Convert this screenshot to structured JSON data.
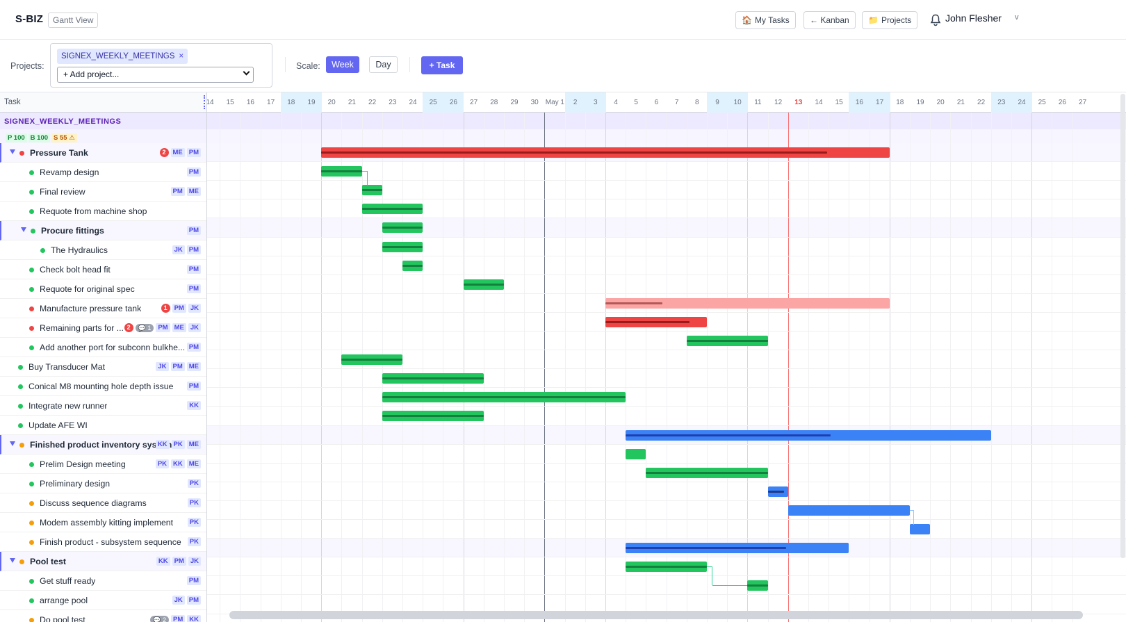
{
  "app": {
    "brand": "S-BIZ",
    "view": "Gantt View"
  },
  "nav": {
    "my_tasks": "My Tasks",
    "kanban": "← Kanban",
    "projects": "Projects",
    "user": "John Flesher",
    "user_caret": "v"
  },
  "filters": {
    "projects_label": "Projects:",
    "project_chip": "SIGNEX_WEEKLY_MEETINGS",
    "chip_remove": "×",
    "add_project": "+ Add project...",
    "scale_label": "Scale:",
    "scale_week": "Week",
    "scale_day": "Day",
    "add_task": "+ Task"
  },
  "gantt": {
    "task_col_header": "Task",
    "project_title": "SIGNEX_WEEKLY_MEETINGS",
    "stats": {
      "p": "P 100",
      "b": "B 100",
      "s": "S 55 ⚠"
    },
    "timescale": [
      "14",
      "15",
      "16",
      "17",
      "18",
      "19",
      "20",
      "21",
      "22",
      "23",
      "24",
      "25",
      "26",
      "27",
      "28",
      "29",
      "30",
      "May 1",
      "2",
      "3",
      "4",
      "5",
      "6",
      "7",
      "8",
      "9",
      "10",
      "11",
      "12",
      "13",
      "14",
      "15",
      "16",
      "17",
      "18",
      "19",
      "20",
      "21",
      "22",
      "23",
      "24",
      "25",
      "26",
      "27"
    ],
    "weekend_idx": [
      4,
      5,
      11,
      12,
      18,
      19,
      25,
      26,
      32,
      33,
      39,
      40
    ],
    "today_idx": 29,
    "first_day": 14,
    "tasks": [
      {
        "name": "Pressure Tank",
        "level": 0,
        "parent": true,
        "dot": "#ef4444",
        "badge": "2",
        "comments": "",
        "tags": [
          "ME",
          "PM"
        ],
        "bar": {
          "start": 6,
          "end": 34,
          "color": "#ef4444",
          "prog_color": "#991b1b",
          "progress": 0.89
        }
      },
      {
        "name": "Revamp design",
        "level": 1,
        "parent": false,
        "dot": "#22c55e",
        "badge": "",
        "comments": "",
        "tags": [
          "PM"
        ],
        "bar": {
          "start": 6,
          "end": 8,
          "color": "#22c55e",
          "prog_color": "#15803d",
          "progress": 1
        }
      },
      {
        "name": "Final review",
        "level": 1,
        "parent": false,
        "dot": "#22c55e",
        "badge": "",
        "comments": "",
        "tags": [
          "PM",
          "ME"
        ],
        "bar": {
          "start": 8,
          "end": 9,
          "color": "#22c55e",
          "prog_color": "#15803d",
          "progress": 1
        }
      },
      {
        "name": "Requote from machine shop",
        "level": 1,
        "parent": false,
        "dot": "#22c55e",
        "badge": "",
        "comments": "",
        "tags": [],
        "bar": {
          "start": 8,
          "end": 11,
          "color": "#22c55e",
          "prog_color": "#15803d",
          "progress": 1
        }
      },
      {
        "name": "Procure fittings",
        "level": 1,
        "parent": true,
        "dot": "#22c55e",
        "badge": "",
        "comments": "",
        "tags": [
          "PM"
        ],
        "bar": {
          "start": 9,
          "end": 11,
          "color": "#22c55e",
          "prog_color": "#15803d",
          "progress": 1
        }
      },
      {
        "name": "The Hydraulics",
        "level": 2,
        "parent": false,
        "dot": "#22c55e",
        "badge": "",
        "comments": "",
        "tags": [
          "JK",
          "PM"
        ],
        "bar": {
          "start": 9,
          "end": 11,
          "color": "#22c55e",
          "prog_color": "#15803d",
          "progress": 1
        }
      },
      {
        "name": "Check bolt head fit",
        "level": 1,
        "parent": false,
        "dot": "#22c55e",
        "badge": "",
        "comments": "",
        "tags": [
          "PM"
        ],
        "bar": {
          "start": 10,
          "end": 11,
          "color": "#22c55e",
          "prog_color": "#15803d",
          "progress": 1
        }
      },
      {
        "name": "Requote for original spec",
        "level": 1,
        "parent": false,
        "dot": "#22c55e",
        "badge": "",
        "comments": "",
        "tags": [
          "PM"
        ],
        "bar": {
          "start": 13,
          "end": 15,
          "color": "#22c55e",
          "prog_color": "#15803d",
          "progress": 1
        }
      },
      {
        "name": "Manufacture pressure tank",
        "level": 1,
        "parent": false,
        "dot": "#ef4444",
        "badge": "1",
        "comments": "",
        "tags": [
          "PM",
          "JK"
        ],
        "bar": {
          "start": 20,
          "end": 34,
          "color": "#fca5a5",
          "prog_color": "#b45858",
          "progress": 0.2
        }
      },
      {
        "name": "Remaining parts for ...",
        "level": 1,
        "parent": false,
        "dot": "#ef4444",
        "badge": "2",
        "comments": "1",
        "tags": [
          "PM",
          "ME",
          "JK"
        ],
        "bar": {
          "start": 20,
          "end": 25,
          "color": "#ef4444",
          "prog_color": "#991b1b",
          "progress": 0.83
        }
      },
      {
        "name": "Add another port for subconn bulkhe...",
        "level": 1,
        "parent": false,
        "dot": "#22c55e",
        "badge": "",
        "comments": "",
        "tags": [
          "PM"
        ],
        "bar": {
          "start": 24,
          "end": 28,
          "color": "#22c55e",
          "prog_color": "#15803d",
          "progress": 1
        }
      },
      {
        "name": "Buy Transducer Mat",
        "level": 0,
        "parent": false,
        "dot": "#22c55e",
        "badge": "",
        "comments": "",
        "tags": [
          "JK",
          "PM",
          "ME"
        ],
        "bar": {
          "start": 7,
          "end": 10,
          "color": "#22c55e",
          "prog_color": "#15803d",
          "progress": 1
        }
      },
      {
        "name": "Conical M8 mounting hole depth issue",
        "level": 0,
        "parent": false,
        "dot": "#22c55e",
        "badge": "",
        "comments": "",
        "tags": [
          "PM"
        ],
        "bar": {
          "start": 9,
          "end": 14,
          "color": "#22c55e",
          "prog_color": "#15803d",
          "progress": 1
        }
      },
      {
        "name": "Integrate new runner",
        "level": 0,
        "parent": false,
        "dot": "#22c55e",
        "badge": "",
        "comments": "",
        "tags": [
          "KK"
        ],
        "bar": {
          "start": 9,
          "end": 21,
          "color": "#22c55e",
          "prog_color": "#15803d",
          "progress": 1
        }
      },
      {
        "name": "Update AFE WI",
        "level": 0,
        "parent": false,
        "dot": "#22c55e",
        "badge": "",
        "comments": "",
        "tags": [],
        "bar": {
          "start": 9,
          "end": 14,
          "color": "#22c55e",
          "prog_color": "#15803d",
          "progress": 1
        }
      },
      {
        "name": "Finished product inventory system",
        "level": 0,
        "parent": true,
        "dot": "#f59e0b",
        "badge": "",
        "comments": "",
        "tags": [
          "KK",
          "PK",
          "ME"
        ],
        "bar": {
          "start": 21,
          "end": 39,
          "color": "#3b82f6",
          "prog_color": "#1e40af",
          "progress": 0.56
        }
      },
      {
        "name": "Prelim Design meeting",
        "level": 1,
        "parent": false,
        "dot": "#22c55e",
        "badge": "",
        "comments": "",
        "tags": [
          "PK",
          "KK",
          "ME"
        ],
        "bar": {
          "start": 21,
          "end": 22,
          "color": "#22c55e",
          "prog_color": "#22c55e",
          "progress": 0
        }
      },
      {
        "name": "Preliminary design",
        "level": 1,
        "parent": false,
        "dot": "#22c55e",
        "badge": "",
        "comments": "",
        "tags": [
          "PK"
        ],
        "bar": {
          "start": 22,
          "end": 28,
          "color": "#22c55e",
          "prog_color": "#15803d",
          "progress": 1
        }
      },
      {
        "name": "Discuss sequence diagrams",
        "level": 1,
        "parent": false,
        "dot": "#f59e0b",
        "badge": "",
        "comments": "",
        "tags": [
          "PK"
        ],
        "bar": {
          "start": 28,
          "end": 29,
          "color": "#3b82f6",
          "prog_color": "#1e3a8a",
          "progress": 0.8
        }
      },
      {
        "name": "Modem assembly kitting implement",
        "level": 1,
        "parent": false,
        "dot": "#f59e0b",
        "badge": "",
        "comments": "",
        "tags": [
          "PK"
        ],
        "bar": {
          "start": 29,
          "end": 35,
          "color": "#3b82f6",
          "prog_color": "#3b82f6",
          "progress": 0
        }
      },
      {
        "name": "Finish product - subsystem sequence",
        "level": 1,
        "parent": false,
        "dot": "#f59e0b",
        "badge": "",
        "comments": "",
        "tags": [
          "PK"
        ],
        "bar": {
          "start": 35,
          "end": 36,
          "color": "#3b82f6",
          "prog_color": "#3b82f6",
          "progress": 0
        }
      },
      {
        "name": "Pool test",
        "level": 0,
        "parent": true,
        "dot": "#f59e0b",
        "badge": "",
        "comments": "",
        "tags": [
          "KK",
          "PM",
          "JK"
        ],
        "bar": {
          "start": 21,
          "end": 32,
          "color": "#3b82f6",
          "prog_color": "#1e40af",
          "progress": 0.72
        }
      },
      {
        "name": "Get stuff ready",
        "level": 1,
        "parent": false,
        "dot": "#22c55e",
        "badge": "",
        "comments": "",
        "tags": [
          "PM"
        ],
        "bar": {
          "start": 21,
          "end": 25,
          "color": "#22c55e",
          "prog_color": "#15803d",
          "progress": 1
        }
      },
      {
        "name": "arrange pool",
        "level": 1,
        "parent": false,
        "dot": "#22c55e",
        "badge": "",
        "comments": "",
        "tags": [
          "JK",
          "PM"
        ],
        "bar": {
          "start": 27,
          "end": 28,
          "color": "#22c55e",
          "prog_color": "#15803d",
          "progress": 1
        }
      },
      {
        "name": "Do pool test",
        "level": 1,
        "parent": false,
        "dot": "#f59e0b",
        "badge": "",
        "comments": "2",
        "tags": [
          "PM",
          "KK"
        ],
        "bar": null
      }
    ]
  },
  "colors": {
    "accent": "#6366f1",
    "today": "#ef4444"
  }
}
